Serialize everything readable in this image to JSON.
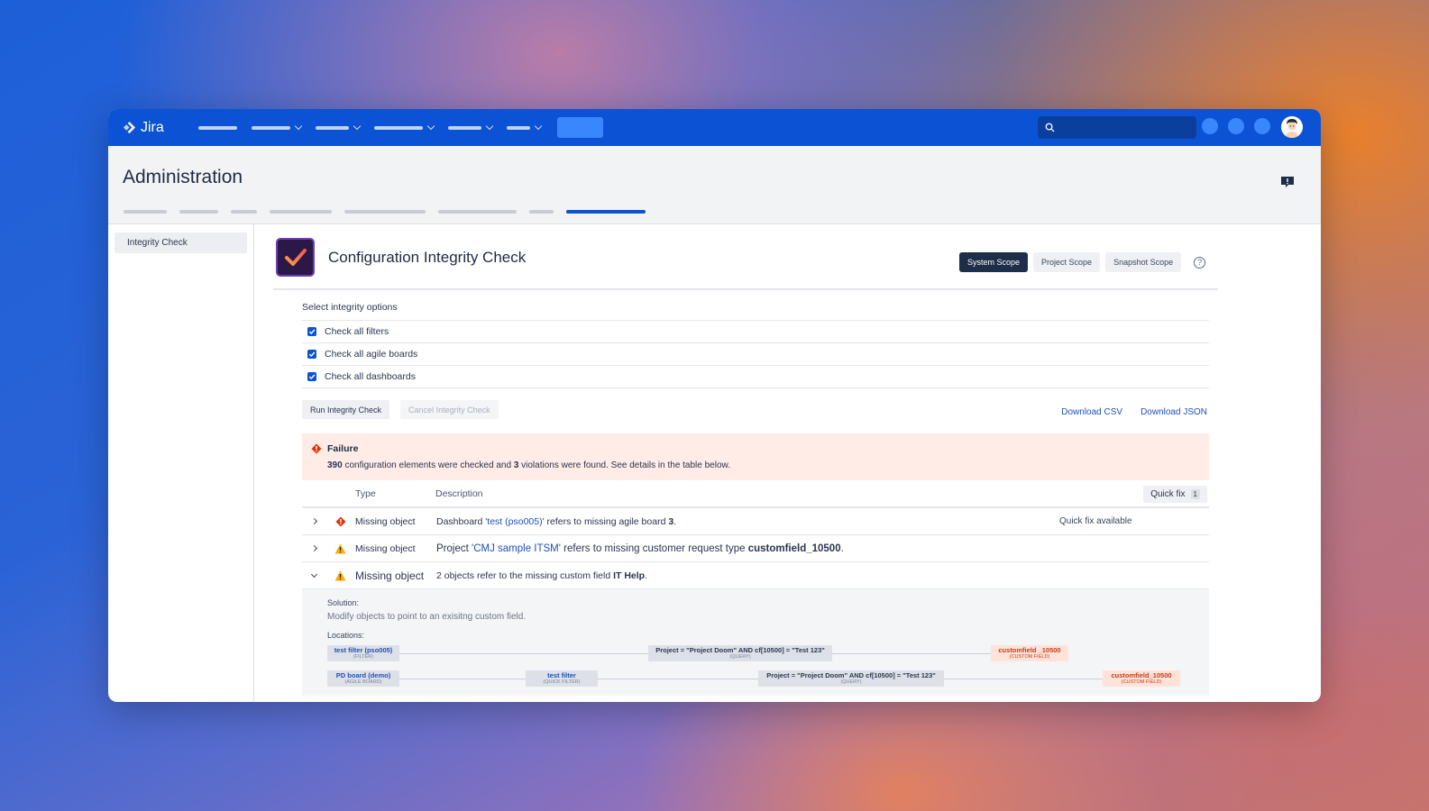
{
  "app": {
    "name": "Jira"
  },
  "search": {
    "placeholder": ""
  },
  "admin": {
    "title": "Administration"
  },
  "sidebar": {
    "items": [
      {
        "label": "Integrity Check"
      }
    ]
  },
  "page": {
    "title": "Configuration Integrity Check"
  },
  "scopes": [
    {
      "label": "System Scope",
      "active": true
    },
    {
      "label": "Project Scope",
      "active": false
    },
    {
      "label": "Snapshot Scope",
      "active": false
    }
  ],
  "options": {
    "title": "Select integrity options",
    "items": [
      {
        "label": "Check all filters",
        "checked": true
      },
      {
        "label": "Check all agile boards",
        "checked": true
      },
      {
        "label": "Check all dashboards",
        "checked": true
      }
    ]
  },
  "actions": {
    "run": "Run Integrity Check",
    "cancel": "Cancel Integrity Check",
    "download_csv": "Download CSV",
    "download_json": "Download JSON"
  },
  "failure": {
    "title": "Failure",
    "checked_count": "390",
    "msg_part1": " configuration elements were checked and ",
    "violation_count": "3",
    "msg_part2": " violations were found. See details in the table below."
  },
  "table": {
    "col_type": "Type",
    "col_desc": "Description",
    "quick_fix_label": "Quick fix",
    "quick_fix_count": "1",
    "rows": [
      {
        "severity": "error",
        "type": "Missing object",
        "prefix": "Dashboard ",
        "link": "'test (pso005)'",
        "middle": " refers to missing agile board ",
        "bold": "3",
        "suffix": ".",
        "quick_fix": "Quick fix available"
      },
      {
        "severity": "warning",
        "type": "Missing object",
        "prefix": "Project ",
        "link": "'CMJ sample ITSM'",
        "middle": " refers to missing customer request type ",
        "bold": "customfield_10500",
        "suffix": "."
      },
      {
        "severity": "warning",
        "type": "Missing object",
        "prefix": "2 objects refer to the missing custom field ",
        "bold": "IT Help",
        "suffix": "."
      }
    ]
  },
  "detail": {
    "solution_label": "Solution:",
    "solution_text": "Modify objects to point to an exisitng custom field.",
    "locations_label": "Locations:",
    "chains": [
      [
        {
          "name": "test filter (pso005)",
          "kind": "(FILTER)"
        },
        {
          "name": "Project = \"Project Doom\" AND cf[10500] = \"Test 123\"",
          "kind": "(QUERY)"
        },
        {
          "name": "customfield _10500",
          "kind": "(CUSTOM FIELD)"
        }
      ],
      [
        {
          "name": "PD board (demo)",
          "kind": "(AGILE BOARD)"
        },
        {
          "name": "test filter",
          "kind": "(QUICK FILTER)"
        },
        {
          "name": "Project = \"Project Doom\" AND cf[10500] = \"Test 123\"",
          "kind": "(QUERY)"
        },
        {
          "name": "customfield_10500",
          "kind": "(CUSTOM FIELD)"
        }
      ]
    ]
  },
  "colors": {
    "nav": "#0b53d4",
    "error": "#de350b",
    "warning": "#ffab00",
    "link": "#1d4fbf",
    "failure_bg": "#ffece6"
  }
}
